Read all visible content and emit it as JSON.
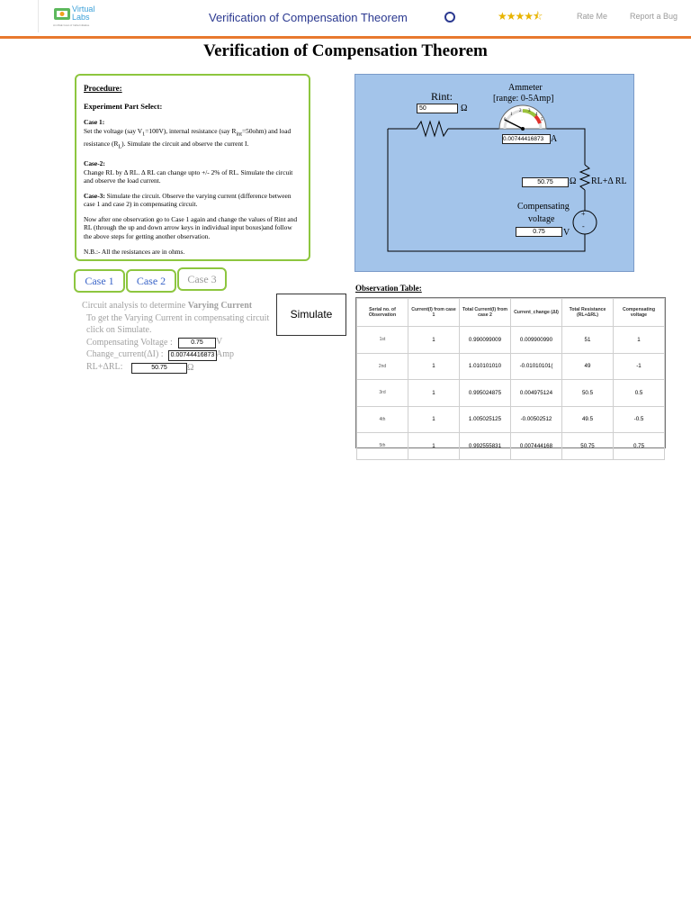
{
  "header": {
    "logo_line1": "Virtual",
    "logo_line2": "Labs",
    "logo_sub": "An MoE Govt of India Initiative",
    "title": "Verification of Compensation Theorem",
    "rating_stars": "★★★★⯪",
    "rate_me": "Rate Me",
    "report_bug": "Report a Bug",
    "accent_color": "#e8792e",
    "title_color": "#2b3990"
  },
  "page_title": "Verification of Compensation Theorem",
  "procedure": {
    "title": "Procedure:",
    "select": "Experiment Part Select:",
    "case1_head": "Case 1:",
    "case1_text_a": "Set the voltage (say V",
    "case1_sub1": "1",
    "case1_text_b": "=100V), internal resistance (say R",
    "case1_sub2": "int",
    "case1_text_c": "=50ohm) and load resistance (R",
    "case1_sub3": "L",
    "case1_text_d": "). Simulate the circuit and observe the current I.",
    "case2_head": "Case-2:",
    "case2_text": "Change RL by Δ RL. Δ RL can change upto +/- 2% of RL. Simulate the circuit and observe the load current.",
    "case3_head": "Case-3:",
    "case3_text": " Simulate the circuit. Observe the varying current (difference between case 1 and case 2) in compensating circuit.",
    "note1": "Now after one observation go to Case 1 again and change the values of Rint and RL (through the up and down arrow keys in individual input boxes)and follow the above steps for getting another observation.",
    "note2": "N.B.:- All the resistances are in ohms."
  },
  "tabs": [
    {
      "label": "Case 1"
    },
    {
      "label": "Case 2"
    },
    {
      "label": "Case 3"
    }
  ],
  "case3": {
    "line1_a": "Circuit analysis to determine ",
    "line1_b": "Varying Current",
    "line2": "To get the Varying Current in compensating circuit",
    "line3": "click on Simulate.",
    "comp_voltage_label": "Compensating Voltage :",
    "comp_voltage_value": "0.75",
    "comp_voltage_unit": "V",
    "change_current_label": "Change_current(ΔI) :",
    "change_current_value": "0.00744416873",
    "change_current_unit": "Amp",
    "rl_label": "RL+ΔRL:",
    "rl_value": "50.75",
    "rl_unit": "Ω",
    "simulate": "Simulate"
  },
  "circuit": {
    "rint_label": "Rint:",
    "rint_value": "50",
    "rint_unit": "Ω",
    "ammeter_title": "Ammeter",
    "ammeter_range": "[range: 0-5Amp]",
    "ammeter_value": "0.00744416873",
    "ammeter_unit": "A",
    "rl_value": "50.75",
    "rl_unit": "Ω",
    "rl_label": "RL+Δ RL",
    "comp_label_1": "Compensating",
    "comp_label_2": "voltage",
    "comp_value": "0.75",
    "comp_unit": "V",
    "plus": "+",
    "minus": "-",
    "dial_ticks": [
      "0",
      "1",
      "2",
      "3",
      "4",
      "5"
    ]
  },
  "observation": {
    "title": "Observation Table:",
    "headers": [
      "Serial no. of Observation",
      "Current(I) from case 1",
      "Total Current(I) from case 2",
      "Current_change (ΔI)",
      "Total Resistance (RL+ΔRL)",
      "Compensating voltage"
    ],
    "rows": [
      [
        "1st",
        "1",
        "0.990099009",
        "0.009900990",
        "51",
        "1"
      ],
      [
        "2nd",
        "1",
        "1.010101010",
        "-0.01010101(",
        "49",
        "-1"
      ],
      [
        "3rd",
        "1",
        "0.995024875",
        "0.004975124",
        "50.5",
        "0.5"
      ],
      [
        "4th",
        "1",
        "1.005025125",
        "-0.00502512",
        "49.5",
        "-0.5"
      ],
      [
        "5th",
        "1",
        "0.992555831",
        "0.007444168",
        "50.75",
        "0.75"
      ]
    ]
  }
}
